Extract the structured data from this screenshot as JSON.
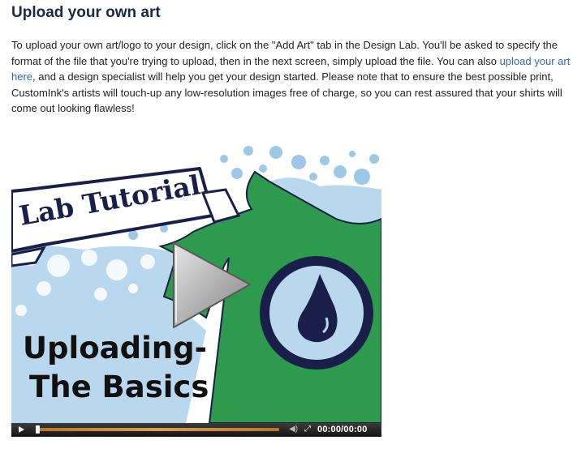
{
  "heading": "Upload your own art",
  "intro": {
    "text_before_link": "To upload your own art/logo to your design, click on the \"Add Art\" tab in the Design Lab. You'll be asked to specify the format of the file that you're trying to upload, then in the next screen, simply upload the file. You can also ",
    "link_text": "upload your art here",
    "text_after_link": ", and a design specialist will help you get your design started. Please note that to ensure the best possible print, CustomInk's artists will touch-up any low-resolution images free of charge, so you can rest assured that your shirts will come out looking flawless!"
  },
  "video": {
    "banner_text": "Lab Tutorial",
    "caption_line1": "Uploading-",
    "caption_line2": "The Basics",
    "time_display": "00:00/00:00",
    "progress": 0,
    "colors": {
      "shirt_green": "#2e9a4e",
      "sky_blue": "#b9d8ee",
      "bubble_blue": "#9ec8e8",
      "navy": "#1a1f4a",
      "progress_orange": "#d9a150"
    },
    "icons": [
      "play-icon",
      "volume-icon",
      "fullscreen-icon",
      "ink-drop-icon"
    ]
  }
}
